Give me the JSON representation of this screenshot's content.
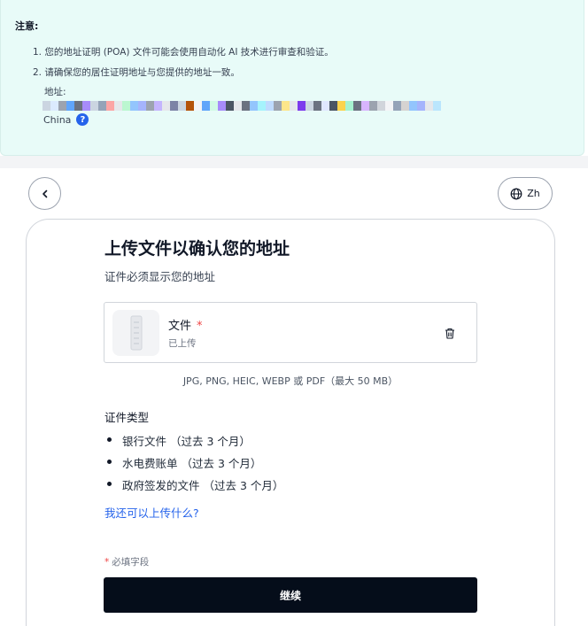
{
  "notice": {
    "title": "注意:",
    "items": [
      "1. 您的地址证明 (POA) 文件可能会使用自动化 AI 技术进行审查和验证。",
      "2. 请确保您的居住证明地址与您提供的地址一致。"
    ],
    "address_label": "地址:",
    "country": "China",
    "help_icon": "question-icon",
    "redaction_colors": [
      "#cbd5e1",
      "#dbeafe",
      "#9ca3af",
      "#60a5fa",
      "#6b7280",
      "#a78bfa",
      "#cbd5e1",
      "#94a3b8",
      "#fca5a5",
      "#e5e7eb",
      "#bbf7d0",
      "#93c5fd",
      "#a5b4fc",
      "#9ca3af",
      "#c4b5fd",
      "#e5e7eb",
      "#7c83a6",
      "#cbd5e1",
      "#b45309",
      "#f3f4f6",
      "#60a5fa",
      "#d1fae5",
      "#a78bfa",
      "#4b5563",
      "#e5e7eb",
      "#6b7280",
      "#93c5fd",
      "#a5f3fc",
      "#bfdbfe",
      "#9ca3af",
      "#fde68a",
      "#e5e7eb",
      "#7c3aed",
      "#cbd5e1",
      "#6b7280",
      "#e0e7ff",
      "#4b5563",
      "#fcd34d",
      "#a7f3d0",
      "#6b7280",
      "#d8b4fe",
      "#9ca3af",
      "#d1d5db",
      "#f3f4f6",
      "#94a3b8",
      "#d6d3d1",
      "#93c5fd",
      "#a5b4fc",
      "#e5e7eb",
      "#bae6fd"
    ]
  },
  "nav": {
    "back_icon": "chevron-left-icon",
    "lang_icon": "globe-icon",
    "lang_label": "Zh"
  },
  "card": {
    "title": "上传文件以确认您的地址",
    "subtitle": "证件必须显示您的地址",
    "file": {
      "label": "文件",
      "required_mark": "*",
      "status": "已上传",
      "thumb_icon": "document-thumbnail-icon",
      "delete_icon": "trash-icon"
    },
    "formats": "JPG, PNG, HEIC, WEBP 或 PDF（最大 50 MB）",
    "doc_types_title": "证件类型",
    "doc_types": [
      "银行文件 （过去 3 个月）",
      "水电费账单 （过去 3 个月）",
      "政府签发的文件 （过去 3 个月）"
    ],
    "more_link": "我还可以上传什么?",
    "required_note_star": "*",
    "required_note": "必填字段",
    "continue_label": "继续"
  },
  "colors": {
    "accent": "#2563eb",
    "button_bg": "#050d1a",
    "notice_bg": "#e8fbf8",
    "required": "#ef4444"
  }
}
